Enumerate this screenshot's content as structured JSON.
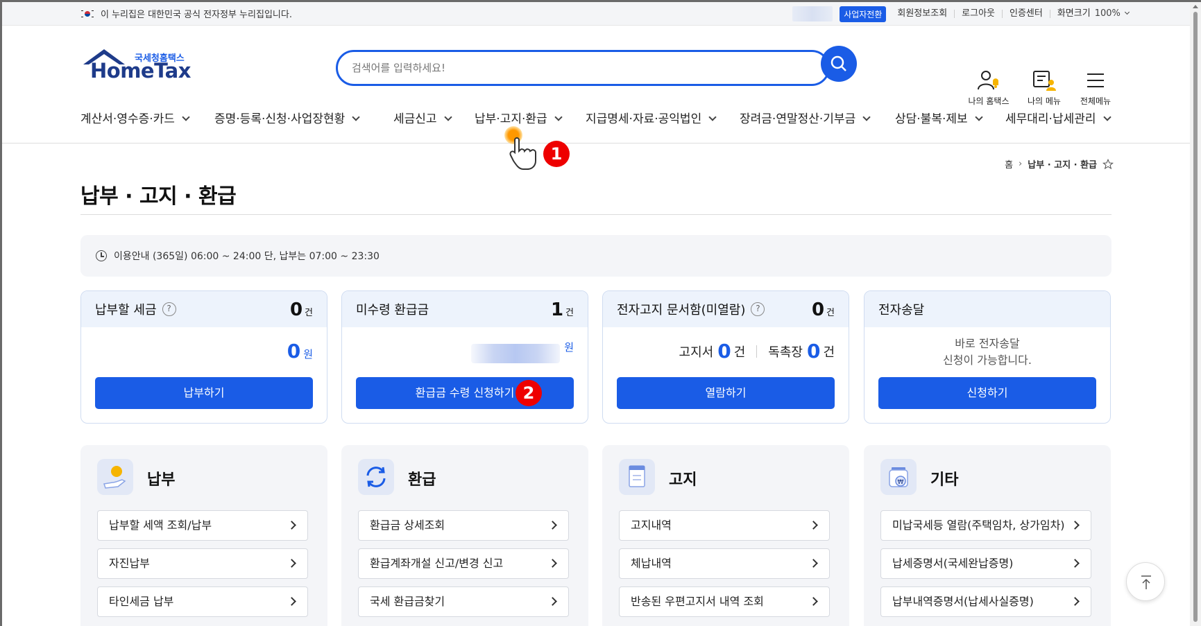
{
  "gov_banner": {
    "text": "이 누리집은 대한민국 공식 전자정부 누리집입니다.",
    "biz_switch": "사업자전환",
    "links": [
      "회원정보조회",
      "로그아웃",
      "인증센터",
      "화면크기"
    ],
    "zoom": "100%"
  },
  "logo": {
    "small": "국세청홈택스",
    "big": "HomeTax"
  },
  "search": {
    "placeholder": "검색어를 입력하세요!"
  },
  "header_icons": {
    "my_hometax": "나의 홈택스",
    "my_menu": "나의 메뉴",
    "all_menu": "전체메뉴"
  },
  "nav": [
    "계산서·영수증·카드",
    "증명·등록·신청·사업장현황",
    "세금신고",
    "납부·고지·환급",
    "지급명세·자료·공익법인",
    "장려금·연말정산·기부금",
    "상담·불복·제보",
    "세무대리·납세관리"
  ],
  "breadcrumb": {
    "home": "홈",
    "current": "납부 · 고지 · 환급"
  },
  "page_title": "납부 · 고지 · 환급",
  "info": "이용안내 (365일) 06:00 ~ 24:00 단, 납부는 07:00 ~ 23:30",
  "cards": {
    "pay": {
      "title": "납부할 세금",
      "count": "0",
      "count_unit": "건",
      "amount": "0",
      "amount_unit": "원",
      "button": "납부하기"
    },
    "refund": {
      "title": "미수령 환급금",
      "count": "1",
      "count_unit": "건",
      "amount_unit": "원",
      "button": "환급금 수령 신청하기"
    },
    "notice": {
      "title": "전자고지 문서함(미열람)",
      "count": "0",
      "count_unit": "건",
      "doc1_label": "고지서",
      "doc1_count": "0",
      "doc2_label": "독촉장",
      "doc2_count": "0",
      "unit": "건",
      "button": "열람하기"
    },
    "edelivery": {
      "title": "전자송달",
      "desc1": "바로 전자송달",
      "desc2": "신청이 가능합니다.",
      "button": "신청하기"
    }
  },
  "sections": {
    "pay": {
      "title": "납부",
      "items": [
        "납부할 세액 조회/납부",
        "자진납부",
        "타인세금 납부"
      ]
    },
    "refund": {
      "title": "환급",
      "items": [
        "환급금 상세조회",
        "환급계좌개설 신고/변경 신고",
        "국세 환급금찾기"
      ]
    },
    "notice": {
      "title": "고지",
      "items": [
        "고지내역",
        "체납내역",
        "반송된 우편고지서 내역 조회"
      ]
    },
    "etc": {
      "title": "기타",
      "items": [
        "미납국세등 열람(주택임차, 상가임차)",
        "납세증명서(국세완납증명)",
        "납부내역증명서(납세사실증명)"
      ]
    }
  },
  "annotations": {
    "step1": "1",
    "step2": "2"
  },
  "colors": {
    "accent": "#1a5ce6",
    "brand_dark": "#1e3b8a",
    "badge": "#e00000"
  }
}
